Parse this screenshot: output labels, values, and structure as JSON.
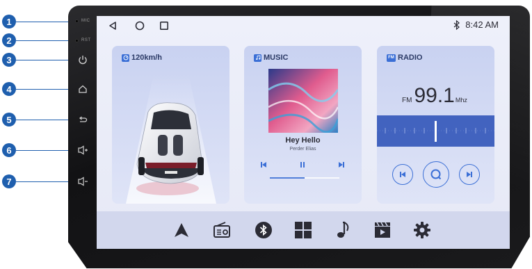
{
  "callouts": [
    "1",
    "2",
    "3",
    "4",
    "5",
    "6",
    "7"
  ],
  "side_labels": {
    "mic": "MIC",
    "rst": "RST"
  },
  "status": {
    "time": "8:42 AM",
    "bluetooth_icon": "bluetooth-icon"
  },
  "nav_icons": [
    "back-triangle-icon",
    "home-circle-icon",
    "recents-square-icon"
  ],
  "speed_card": {
    "title": "120km/h"
  },
  "music_card": {
    "title": "MUSIC",
    "song": "Hey Hello",
    "artist": "Perder Elias",
    "progress": 0.5
  },
  "radio_card": {
    "title": "RADIO",
    "tag": "FM",
    "band": "FM",
    "frequency": "99.1",
    "unit": "Mhz"
  },
  "dock": [
    "navigation-icon",
    "radio-icon",
    "bluetooth-icon",
    "apps-grid-icon",
    "music-note-icon",
    "video-icon",
    "settings-gear-icon"
  ],
  "colors": {
    "accent": "#1f5fae",
    "screen": "#eef0fa",
    "card": "#cfd7f2",
    "dock": "#d2d7ed",
    "icon": "#2b2b35"
  }
}
